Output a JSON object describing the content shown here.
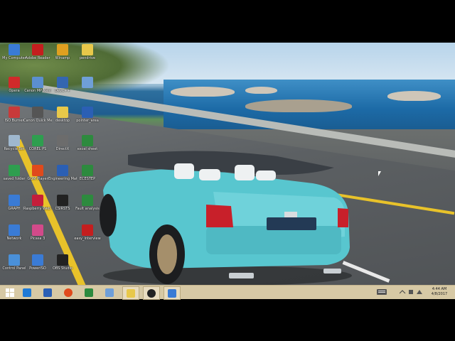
{
  "desktop": {
    "icons": [
      {
        "label": "My Computer",
        "icon": "computer-icon",
        "color": "#3a7bd5"
      },
      {
        "label": "Adobe Reader",
        "icon": "pdf-icon",
        "color": "#c41e1e"
      },
      {
        "label": "Winamp",
        "icon": "winamp-icon",
        "color": "#e0a020"
      },
      {
        "label": "pendrive",
        "icon": "folder-icon",
        "color": "#e8c84a"
      },
      {
        "label": "Opera",
        "icon": "opera-icon",
        "color": "#d12a2a"
      },
      {
        "label": "Canon MP Navi",
        "icon": "canon-icon",
        "color": "#5b8fd0"
      },
      {
        "label": "DevC++",
        "icon": "devcpp-icon",
        "color": "#3466b0"
      },
      {
        "label": "",
        "icon": "document-icon",
        "color": "#6f9fd8"
      },
      {
        "label": "ISO Burner",
        "icon": "iso-icon",
        "color": "#c83a3a"
      },
      {
        "label": "Canon Quick Menu",
        "icon": "canon-menu-icon",
        "color": "#555"
      },
      {
        "label": "desktop",
        "icon": "folder-icon",
        "color": "#e8c84a"
      },
      {
        "label": "pointer_area",
        "icon": "word-doc-icon",
        "color": "#2b5fb4"
      },
      {
        "label": "Recycle Bin",
        "icon": "recycle-bin-icon",
        "color": "#9fb8cf"
      },
      {
        "label": "COREL PS",
        "icon": "corel-icon",
        "color": "#2e9e4f"
      },
      {
        "label": "DirectX",
        "icon": "directx-icon",
        "color": "#6c6c6c"
      },
      {
        "label": "excel sheet",
        "icon": "excel-icon",
        "color": "#2d8a3e"
      },
      {
        "label": "saved folder",
        "icon": "folder-icon",
        "color": "#2e9e4f"
      },
      {
        "label": "GOM Player",
        "icon": "gom-icon",
        "color": "#e04a1c"
      },
      {
        "label": "Engineering Mathematics",
        "icon": "doc-icon",
        "color": "#2b5fb4"
      },
      {
        "label": "ECESTEP",
        "icon": "excel-icon",
        "color": "#2d8a3e"
      },
      {
        "label": "GRAPH",
        "icon": "graph-icon",
        "color": "#3a7bd5"
      },
      {
        "label": "Raspberry Web Server",
        "icon": "raspberry-icon",
        "color": "#c41e3a"
      },
      {
        "label": "CSIRSTS",
        "icon": "terminal-icon",
        "color": "#222"
      },
      {
        "label": "Fault analysis",
        "icon": "excel-icon",
        "color": "#2d8a3e"
      },
      {
        "label": "Network",
        "icon": "network-icon",
        "color": "#3a7bd5"
      },
      {
        "label": "Picasa 3",
        "icon": "picasa-icon",
        "color": "#d24a8a"
      },
      {
        "label": "",
        "icon": "blank-icon",
        "color": "#00000000"
      },
      {
        "label": "easy_interview",
        "icon": "pdf-icon",
        "color": "#c41e1e"
      },
      {
        "label": "Control Panel",
        "icon": "control-panel-icon",
        "color": "#4a90d9"
      },
      {
        "label": "PowerISO",
        "icon": "poweriso-icon",
        "color": "#3a7bd5"
      },
      {
        "label": "OBS Studio",
        "icon": "obs-icon",
        "color": "#222"
      }
    ]
  },
  "taskbar": {
    "start_icon": "windows-start-icon",
    "pinned": [
      {
        "name": "internet-explorer-icon",
        "color": "#1f7ad6"
      },
      {
        "name": "word-icon",
        "color": "#2b5fb4"
      },
      {
        "name": "chrome-icon",
        "color": "#e04a1c"
      },
      {
        "name": "excel-icon",
        "color": "#2d8a3e"
      },
      {
        "name": "notepad-icon",
        "color": "#6f9fd8"
      },
      {
        "name": "file-explorer-icon",
        "color": "#e8c84a"
      },
      {
        "name": "obs-icon",
        "color": "#222"
      },
      {
        "name": "image-viewer-icon",
        "color": "#3a7bd5"
      }
    ],
    "tray": {
      "keyboard_icon": "keyboard-icon",
      "time": "4:44 AM",
      "date": "4/8/2017"
    }
  }
}
